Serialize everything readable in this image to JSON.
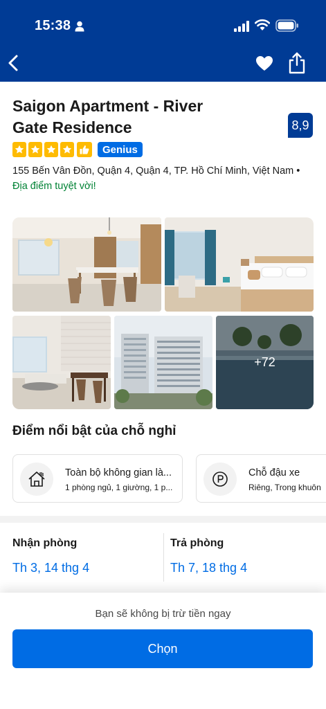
{
  "status_bar": {
    "time": "15:38"
  },
  "header": {
    "icons": [
      "back-arrow-icon",
      "heart-icon",
      "share-icon"
    ],
    "background_color": "#003b95"
  },
  "property": {
    "name": "Saigon Apartment - River Gate Residence",
    "score": "8,9",
    "stars": 4,
    "genius_label": "Genius",
    "address": "155 Bến Vân Đồn, Quận 4, Quận 4, TP. Hồ Chí Minh, Việt Nam •",
    "location_praise": "Địa điểm tuyệt vời!"
  },
  "photos": {
    "more_count_label": "+72"
  },
  "highlights": {
    "title": "Điểm nổi bật của chỗ nghỉ",
    "items": [
      {
        "icon": "house-icon",
        "title": "Toàn bộ không gian là...",
        "subtitle": "1 phòng ngủ, 1 giường, 1 p..."
      },
      {
        "icon": "parking-icon",
        "title": "Chỗ đậu xe",
        "subtitle": "Riêng, Trong khuôn"
      }
    ]
  },
  "dates": {
    "checkin_label": "Nhận phòng",
    "checkin_value": "Th 3, 14 thg 4",
    "checkout_label": "Trả phòng",
    "checkout_value": "Th 7, 18 thg 4"
  },
  "footer": {
    "notice": "Bạn sẽ không bị trừ tiền ngay",
    "button_label": "Chọn"
  },
  "colors": {
    "brand_dark": "#003b95",
    "accent_blue": "#006ce4",
    "star_yellow": "#febb02",
    "positive_green": "#008234"
  }
}
